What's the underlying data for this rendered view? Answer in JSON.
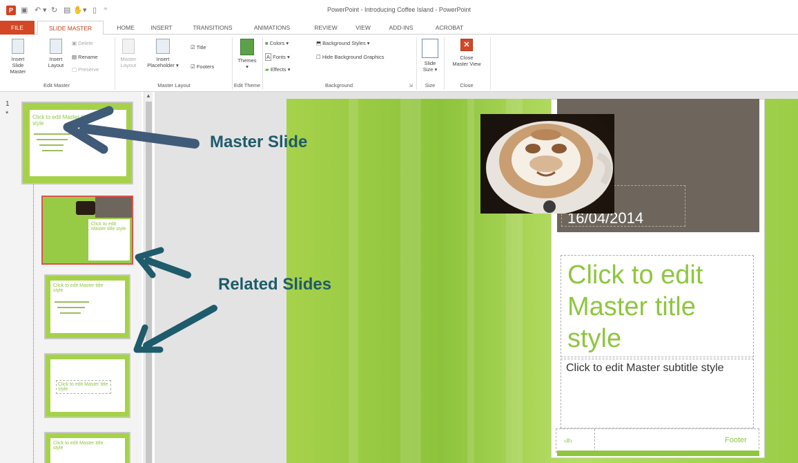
{
  "window": {
    "title": "PowerPoint - Introducing Coffee Island - PowerPoint"
  },
  "tabs": [
    "FILE",
    "SLIDE MASTER",
    "HOME",
    "INSERT",
    "TRANSITIONS",
    "ANIMATIONS",
    "REVIEW",
    "VIEW",
    "ADD-INS",
    "ACROBAT"
  ],
  "ribbon": {
    "edit_master": {
      "label": "Edit Master",
      "insert_slide_master_1": "Insert Slide",
      "insert_slide_master_2": "Master",
      "insert_layout_1": "Insert",
      "insert_layout_2": "Layout",
      "delete": "Delete",
      "rename": "Rename",
      "preserve": "Preserve"
    },
    "master_layout": {
      "label": "Master Layout",
      "master_layout_1": "Master",
      "master_layout_2": "Layout",
      "insert_placeholder_1": "Insert",
      "insert_placeholder_2": "Placeholder ▾",
      "title": "Title",
      "footers": "Footers"
    },
    "edit_theme": {
      "label": "Edit Theme",
      "themes": "Themes"
    },
    "background": {
      "label": "Background",
      "colors": "Colors ▾",
      "fonts": "Fonts ▾",
      "effects": "Effects ▾",
      "background_styles": "Background Styles ▾",
      "hide_background_graphics": "Hide Background Graphics"
    },
    "size": {
      "label": "Size",
      "slide_size_1": "Slide",
      "slide_size_2": "Size ▾"
    },
    "close": {
      "label": "Close",
      "close_master_view_1": "Close",
      "close_master_view_2": "Master View"
    }
  },
  "thumbnails": {
    "number": "1",
    "star": "*",
    "master_text": "Click to edit Master title style",
    "layout_text": "Click to edit Master title style"
  },
  "slide": {
    "date": "16/04/2014",
    "title": "Click to edit Master title style",
    "subtitle": "Click to edit Master subtitle style",
    "page_number": "‹#›",
    "footer": "Footer"
  },
  "annotations": {
    "master_slide": "Master Slide",
    "related_slides": "Related Slides"
  },
  "colors": {
    "accent": "#d24726",
    "slide_green": "#8ec63f",
    "annotation": "#1e5b6b"
  }
}
